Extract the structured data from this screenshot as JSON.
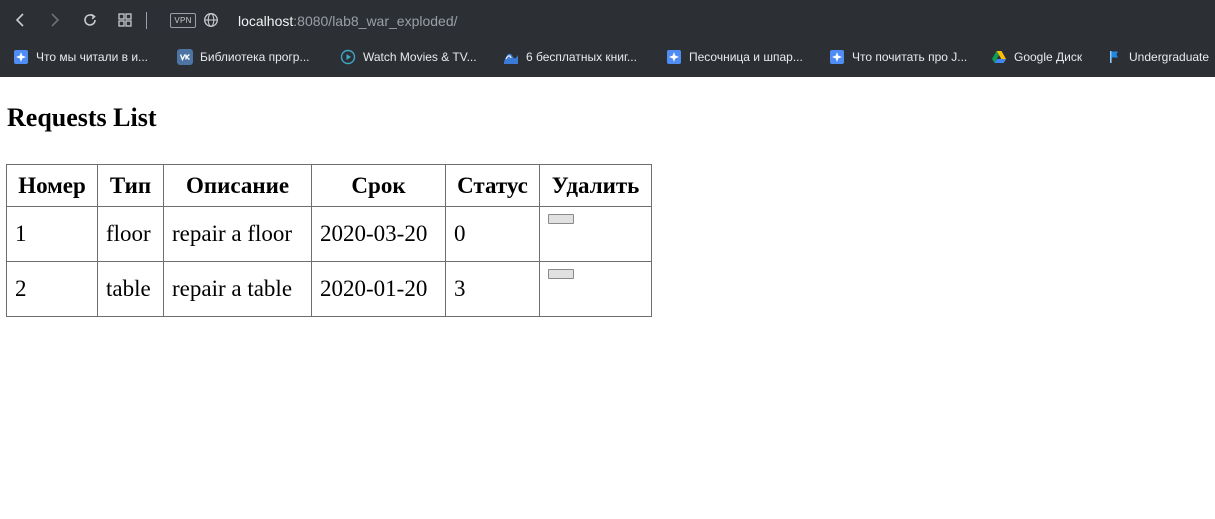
{
  "browser": {
    "url_host": "localhost",
    "url_path": ":8080/lab8_war_exploded/",
    "vpn_label": "VPN",
    "nav_icons": [
      "back-icon",
      "forward-icon",
      "reload-icon",
      "tabs-grid-icon",
      "globe-icon"
    ],
    "bookmarks": [
      {
        "label": "Что мы читали в и...",
        "icon": "puzzle-icon",
        "color": "#4f8df5"
      },
      {
        "label": "Библиотека прогр...",
        "icon": "vk-icon",
        "color": "#4c75a3"
      },
      {
        "label": "Watch Movies & TV...",
        "icon": "play-circle-icon",
        "color": "#3ea6c7"
      },
      {
        "label": "6 бесплатных книг...",
        "icon": "wave-icon",
        "color": "#3b7bd8"
      },
      {
        "label": "Песочница и шпар...",
        "icon": "puzzle-icon",
        "color": "#4f8df5"
      },
      {
        "label": "Что почитать про J...",
        "icon": "puzzle-icon",
        "color": "#4f8df5"
      },
      {
        "label": "Google Диск",
        "icon": "google-drive-icon",
        "color": "#fbbc04"
      },
      {
        "label": "Undergraduate",
        "icon": "flag-icon",
        "color": "#1e88e5"
      }
    ]
  },
  "page": {
    "title": "Requests List",
    "table": {
      "headers": [
        "Номер",
        "Тип",
        "Описание",
        "Срок",
        "Статус",
        "Удалить"
      ],
      "rows": [
        [
          "1",
          "floor",
          "repair a floor",
          "2020-03-20",
          "0"
        ],
        [
          "2",
          "table",
          "repair a table",
          "2020-01-20",
          "3"
        ]
      ]
    }
  }
}
